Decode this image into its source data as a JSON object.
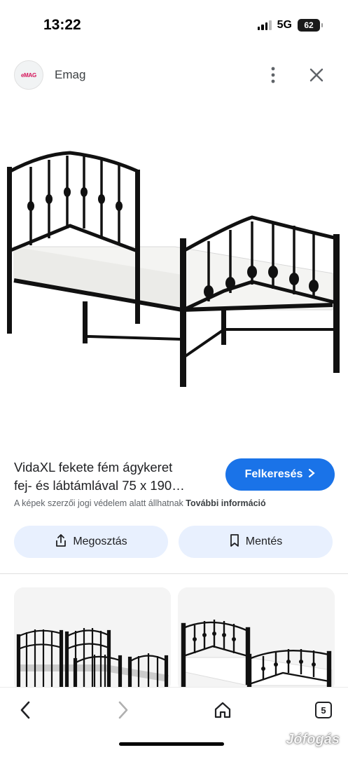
{
  "status_bar": {
    "time": "13:22",
    "network": "5G",
    "battery": "62"
  },
  "header": {
    "site_logo_text": "eMAG",
    "site_name": "Emag",
    "menu_icon": "more-vert-icon",
    "close_icon": "close-icon"
  },
  "product": {
    "title_line1": "VidaXL fekete fém ágykeret",
    "title_line2": "fej- és lábtámlával 75 x 190…",
    "visit_label": "Felkeresés",
    "copyright_text": "A képek szerzői jogi védelem alatt állhatnak",
    "more_info_label": "További információ"
  },
  "actions": {
    "share_label": "Megosztás",
    "save_label": "Mentés"
  },
  "bottom_nav": {
    "tab_count": "5"
  },
  "watermark": "Jófogás",
  "colors": {
    "accent": "#1a73e8",
    "action_bg": "#e8f0fe"
  }
}
